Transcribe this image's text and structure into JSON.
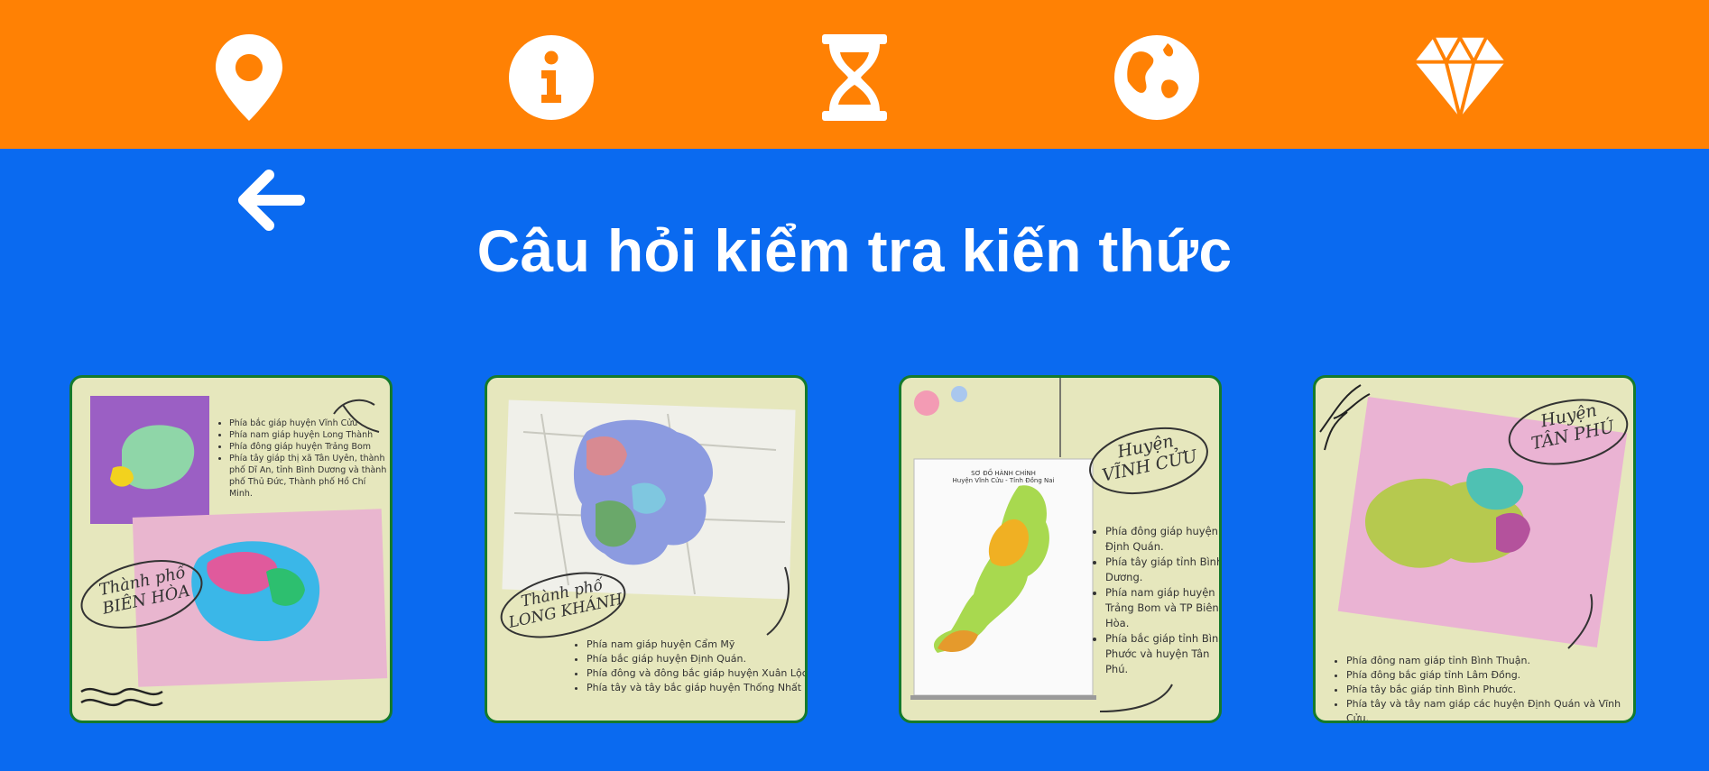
{
  "colors": {
    "topbar": "#ff8104",
    "background": "#0a6af0",
    "card_border": "#157a2c",
    "card_bg": "#e6e7bd"
  },
  "nav": {
    "icons": [
      "location-pin-icon",
      "info-icon",
      "hourglass-icon",
      "globe-icon",
      "diamond-icon"
    ]
  },
  "back_icon": "arrow-left-icon",
  "page_title": "Câu hỏi kiểm tra kiến thức",
  "cards": [
    {
      "label": [
        "Thành phố",
        "BIÊN HÒA"
      ],
      "bullets": [
        "Phía bắc giáp huyện Vĩnh Cửu",
        "Phía nam giáp huyện Long Thành",
        "Phía đông giáp huyện Trảng Bom",
        "Phía tây giáp thị xã Tân Uyên, thành phố Dĩ An, tỉnh Bình Dương và thành phố Thủ Đức, Thành phố Hồ Chí Minh."
      ]
    },
    {
      "label": [
        "Thành phố",
        "LONG KHÁNH"
      ],
      "bullets": [
        "Phía nam giáp huyện Cẩm Mỹ",
        "Phía bắc giáp huyện Định Quán.",
        "Phía đông và đông bắc giáp huyện Xuân Lộc",
        "Phía tây và tây bắc giáp huyện Thống Nhất"
      ]
    },
    {
      "label": [
        "Huyện",
        "VĨNH CỬU"
      ],
      "map_title": [
        "SƠ ĐỒ HÀNH CHÍNH",
        "Huyện Vĩnh Cửu - Tỉnh Đồng Nai"
      ],
      "bullets": [
        "Phía đông giáp huyện Định Quán.",
        "Phía tây giáp tỉnh Bình Dương.",
        "Phía nam giáp huyện Trảng Bom và TP Biên Hòa.",
        "Phía bắc giáp tỉnh Bình Phước và huyện Tân Phú."
      ]
    },
    {
      "label": [
        "Huyện",
        "TÂN PHÚ"
      ],
      "bullets": [
        "Phía đông nam giáp tỉnh Bình Thuận.",
        "Phía đông bắc giáp tỉnh Lâm Đồng.",
        "Phía tây bắc giáp tỉnh Bình Phước.",
        "Phía tây và tây nam giáp các huyện Định Quán và Vĩnh Cửu."
      ]
    }
  ]
}
